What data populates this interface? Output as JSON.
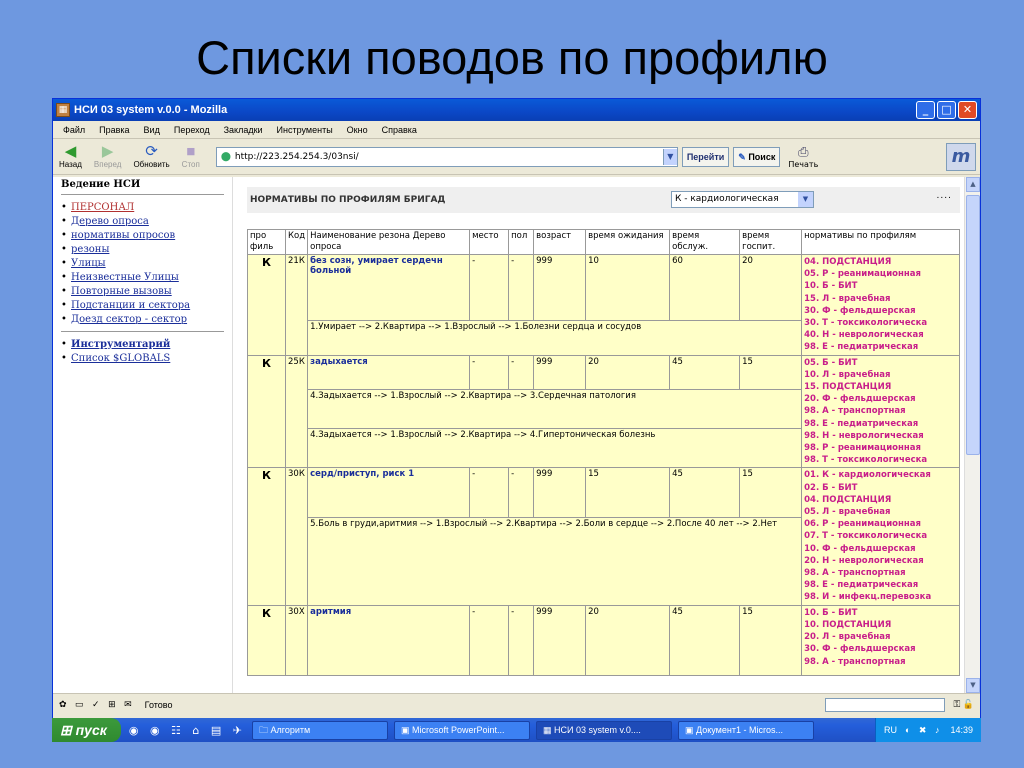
{
  "slide": {
    "title": "Списки поводов по профилю"
  },
  "window": {
    "title": "НСИ 03 system v.0.0 - Mozilla",
    "minimize": "_",
    "maximize": "□",
    "close": "✕"
  },
  "menu": [
    "Файл",
    "Правка",
    "Вид",
    "Переход",
    "Закладки",
    "Инструменты",
    "Окно",
    "Справка"
  ],
  "nav": {
    "back": "Назад",
    "forward": "Вперед",
    "refresh": "Обновить",
    "stop": "Стоп",
    "go": "Перейти",
    "search": "Поиск",
    "print": "Печать"
  },
  "address": {
    "value": "http://223.254.254.3/03nsi/"
  },
  "sidebar": {
    "heading": "Ведение НСИ",
    "items": [
      "ПЕРСОНАЛ",
      "Дерево опроса",
      "нормативы опросов",
      "резоны",
      "Улицы",
      "Неизвестные Улицы",
      "Повторные вызовы",
      "Подстанции и сектора",
      "Доезд сектор - сектор"
    ],
    "tools": [
      "Инструментарий",
      "Список $GLOBALS"
    ]
  },
  "main": {
    "title": "НОРМАТИВЫ ПО ПРОФИЛЯМ БРИГАД",
    "profile_select": "К - кардиологическая",
    "dots": "....",
    "columns": [
      "про филь",
      "Код",
      "Наименование резона Дерево опроса",
      "место",
      "пол",
      "возраст",
      "время ожидания",
      "время обслуж.",
      "время госпит.",
      "нормативы по профилям"
    ],
    "rows": [
      {
        "profile": "К",
        "code": "21К",
        "reason": "без созн, умирает сердечн больной",
        "place": "-",
        "sex": "-",
        "age": "999",
        "wait": "10",
        "service": "60",
        "hosp": "20",
        "trees": [
          "1.Умирает --> 2.Квартира --> 1.Взрослый --> 1.Болезни сердца и сосудов"
        ],
        "norms": [
          "04. ПОДСТАНЦИЯ",
          "05. Р - реанимационная",
          "10. Б - БИТ",
          "15. Л - врачебная",
          "30. Ф - фельдшерская",
          "30. Т - токсикологическа",
          "40. Н - неврологическая",
          "98. Е - педиатрическая"
        ]
      },
      {
        "profile": "К",
        "code": "25К",
        "reason": "задыхается",
        "place": "-",
        "sex": "-",
        "age": "999",
        "wait": "20",
        "service": "45",
        "hosp": "15",
        "trees": [
          "4.Задыхается --> 1.Взрослый --> 2.Квартира --> 3.Сердечная патология",
          "4.Задыхается --> 1.Взрослый --> 2.Квартира --> 4.Гипертоническая болезнь"
        ],
        "norms": [
          "05. Б - БИТ",
          "10. Л - врачебная",
          "15. ПОДСТАНЦИЯ",
          "20. Ф - фельдшерская",
          "98. А - транспортная",
          "98. Е - педиатрическая",
          "98. Н - неврологическая",
          "98. Р - реанимационная",
          "98. Т - токсикологическа"
        ]
      },
      {
        "profile": "К",
        "code": "30К",
        "reason": "серд/приступ, риск 1",
        "place": "-",
        "sex": "-",
        "age": "999",
        "wait": "15",
        "service": "45",
        "hosp": "15",
        "trees": [
          "5.Боль в груди,аритмия --> 1.Взрослый --> 2.Квартира --> 2.Боли в сердце --> 2.После 40 лет --> 2.Нет"
        ],
        "norms": [
          "01. К - кардиологическая",
          "02. Б - БИТ",
          "04. ПОДСТАНЦИЯ",
          "05. Л - врачебная",
          "06. Р - реанимационная",
          "07. Т - токсикологическа",
          "10. Ф - фельдшерская",
          "20. Н - неврологическая",
          "98. А - транспортная",
          "98. Е - педиатрическая",
          "98. И - инфекц.перевозка"
        ]
      },
      {
        "profile": "К",
        "code": "30Х",
        "reason": "аритмия",
        "place": "-",
        "sex": "-",
        "age": "999",
        "wait": "20",
        "service": "45",
        "hosp": "15",
        "trees": [],
        "norms": [
          "10. Б - БИТ",
          "10. ПОДСТАНЦИЯ",
          "20. Л - врачебная",
          "30. Ф - фельдшерская",
          "98. А - транспортная"
        ]
      }
    ]
  },
  "status": {
    "text": "Готово"
  },
  "taskbar": {
    "start": "пуск",
    "tasks": [
      "Алгоритм",
      "Microsoft PowerPoint...",
      "НСИ 03 system v.0....",
      "Документ1 - Micros..."
    ],
    "lang": "RU",
    "time": "14:39"
  }
}
